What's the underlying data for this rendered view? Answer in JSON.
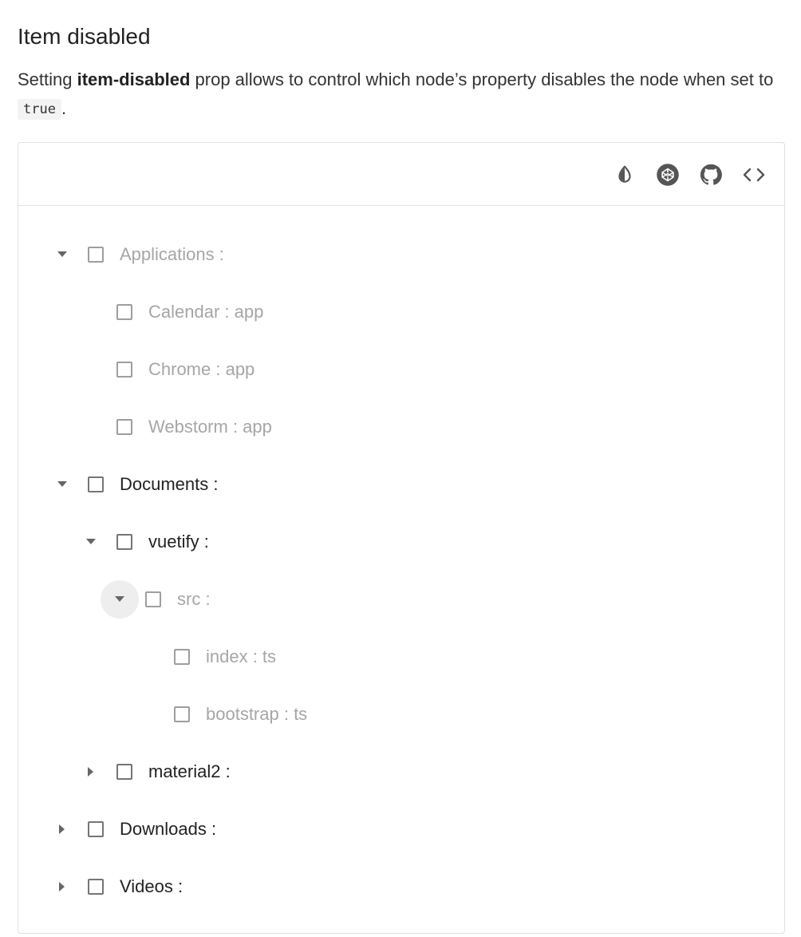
{
  "section": {
    "title": "Item disabled",
    "desc_prefix": "Setting ",
    "desc_prop": "item-disabled",
    "desc_suffix": " prop allows to control which node’s property disables the node when set to ",
    "desc_code": "true",
    "desc_end": "."
  },
  "toolbar": {
    "buttons": [
      {
        "name": "invert-colors-icon"
      },
      {
        "name": "codepen-icon"
      },
      {
        "name": "github-icon"
      },
      {
        "name": "code-icon"
      }
    ]
  },
  "colors": {
    "enabled_text": "#222222",
    "disabled_text": "#a6a6a6",
    "checkbox_border": "#757575",
    "active_toggle_bg": "#eeeeee"
  },
  "tree": [
    {
      "label": "Applications :",
      "level": 0,
      "toggle": "expanded",
      "disabled": true
    },
    {
      "label": "Calendar : app",
      "level": 1,
      "toggle": "none",
      "disabled": true
    },
    {
      "label": "Chrome : app",
      "level": 1,
      "toggle": "none",
      "disabled": true
    },
    {
      "label": "Webstorm : app",
      "level": 1,
      "toggle": "none",
      "disabled": true
    },
    {
      "label": "Documents :",
      "level": 0,
      "toggle": "expanded",
      "disabled": false
    },
    {
      "label": "vuetify :",
      "level": 1,
      "toggle": "expanded",
      "disabled": false
    },
    {
      "label": "src :",
      "level": 2,
      "toggle": "expanded",
      "disabled": true,
      "active": true
    },
    {
      "label": "index : ts",
      "level": 3,
      "toggle": "none",
      "disabled": true
    },
    {
      "label": "bootstrap : ts",
      "level": 3,
      "toggle": "none",
      "disabled": true
    },
    {
      "label": "material2 :",
      "level": 1,
      "toggle": "collapsed",
      "disabled": false
    },
    {
      "label": "Downloads :",
      "level": 0,
      "toggle": "collapsed",
      "disabled": false
    },
    {
      "label": "Videos :",
      "level": 0,
      "toggle": "collapsed",
      "disabled": false
    }
  ]
}
